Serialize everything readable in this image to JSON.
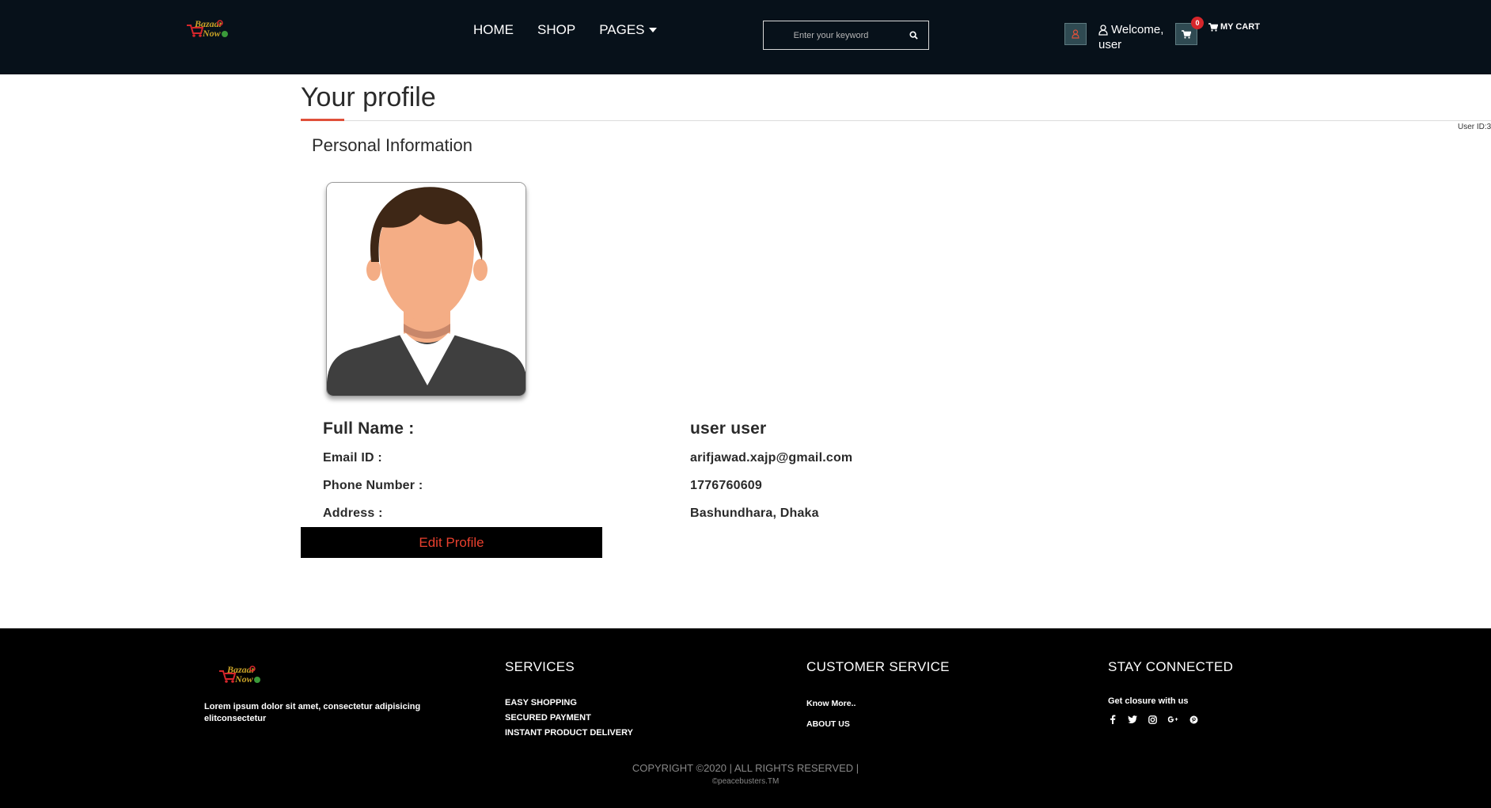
{
  "header": {
    "logo_text_top": "Bazaar",
    "logo_text_bottom": "Now",
    "nav": [
      {
        "label": "HOME"
      },
      {
        "label": "SHOP"
      },
      {
        "label": "PAGES"
      }
    ],
    "search": {
      "placeholder": "Enter your keyword"
    },
    "welcome_line1": "Welcome,",
    "welcome_line2": "user",
    "cart_count": "0",
    "cart_label": "MY CART"
  },
  "main": {
    "title": "Your profile",
    "user_id_label": "User ID:3",
    "section_title": "Personal Information",
    "fields": {
      "fullname_label": "Full Name :",
      "fullname_value": "user user",
      "email_label": "Email ID :",
      "email_value": "arifjawad.xajp@gmail.com",
      "phone_label": "Phone Number :",
      "phone_value": "1776760609",
      "address_label": "Address :",
      "address_value": "Bashundhara, Dhaka"
    },
    "edit_button": "Edit Profile"
  },
  "footer": {
    "description": "Lorem ipsum dolor sit amet, consectetur adipisicing elitconsectetur",
    "services_heading": "SERVICES",
    "services": [
      "EASY SHOPPING",
      "SECURED PAYMENT",
      "INSTANT PRODUCT DELIVERY"
    ],
    "customer_heading": "CUSTOMER SERVICE",
    "customer_links": [
      "Know More..",
      "ABOUT US"
    ],
    "connected_heading": "STAY CONNECTED",
    "connected_text": "Get closure with us",
    "social_icons": [
      "facebook-icon",
      "twitter-icon",
      "instagram-icon",
      "google-plus-icon",
      "pinterest-icon"
    ],
    "copyright": "COPYRIGHT ©2020 | ALL RIGHTS RESERVED |",
    "credit": "©peacebusters.TM"
  },
  "colors": {
    "header_bg": "#07111a",
    "accent": "#e0503a",
    "button_bg": "#000000",
    "badge": "#d6262b"
  }
}
